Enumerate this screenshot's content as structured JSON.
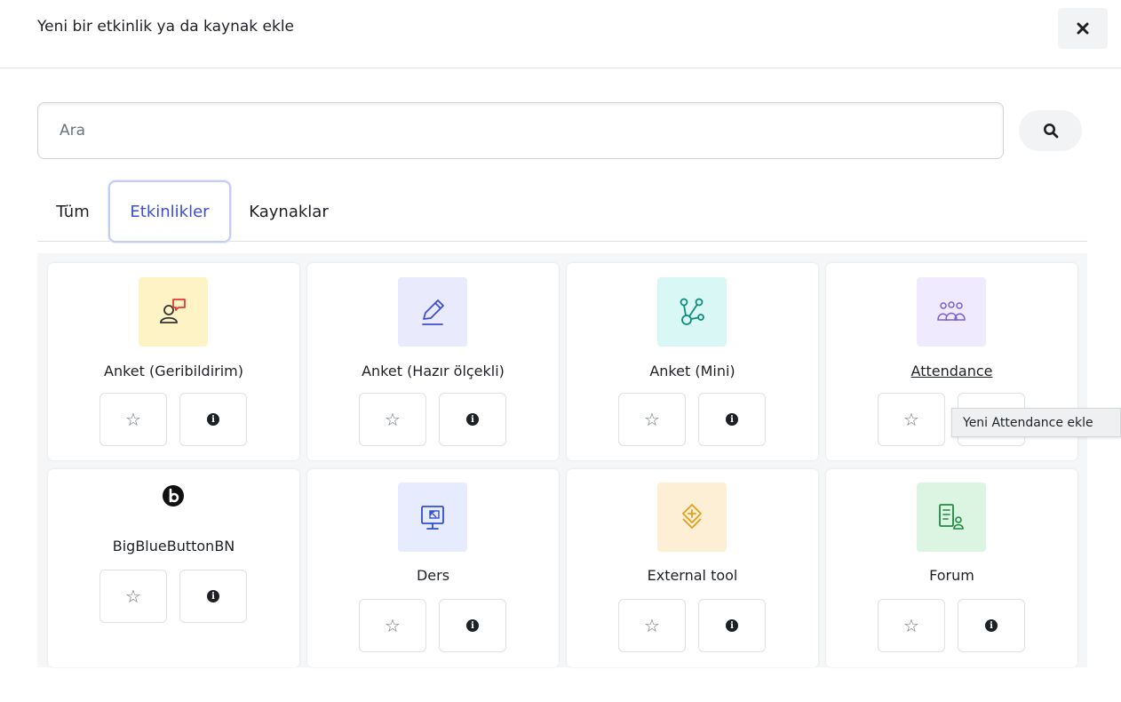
{
  "modal": {
    "title": "Yeni bir etkinlik ya da kaynak ekle",
    "close_label": "×"
  },
  "search": {
    "placeholder": "Ara"
  },
  "tabs": [
    {
      "label": "Tüm",
      "active": false
    },
    {
      "label": "Etkinlikler",
      "active": true
    },
    {
      "label": "Kaynaklar",
      "active": false
    }
  ],
  "cards": [
    {
      "name": "Anket (Geribildirim)",
      "icon": "feedback-icon",
      "icon_bg": "#fdf3c4"
    },
    {
      "name": "Anket (Hazır ölçekli)",
      "icon": "pencil-icon",
      "icon_bg": "#e9ebfc"
    },
    {
      "name": "Anket (Mini)",
      "icon": "branch-icon",
      "icon_bg": "#d9f7f4"
    },
    {
      "name": "Attendance",
      "icon": "group-icon",
      "icon_bg": "#efeafd",
      "hovered": true
    },
    {
      "name": "BigBlueButtonBN",
      "icon": "bigbluebutton-icon",
      "icon_bg": "#ffffff"
    },
    {
      "name": "Ders",
      "icon": "presentation-icon",
      "icon_bg": "#e6ecfd"
    },
    {
      "name": "External tool",
      "icon": "puzzle-icon",
      "icon_bg": "#fcefd6"
    },
    {
      "name": "Forum",
      "icon": "forum-icon",
      "icon_bg": "#dcf5e3"
    }
  ],
  "tooltip": {
    "text": "Yeni Attendance ekle"
  },
  "colors": {
    "accent": "#3c4ed4",
    "star": "#6a737b",
    "info": "#1d2125"
  }
}
